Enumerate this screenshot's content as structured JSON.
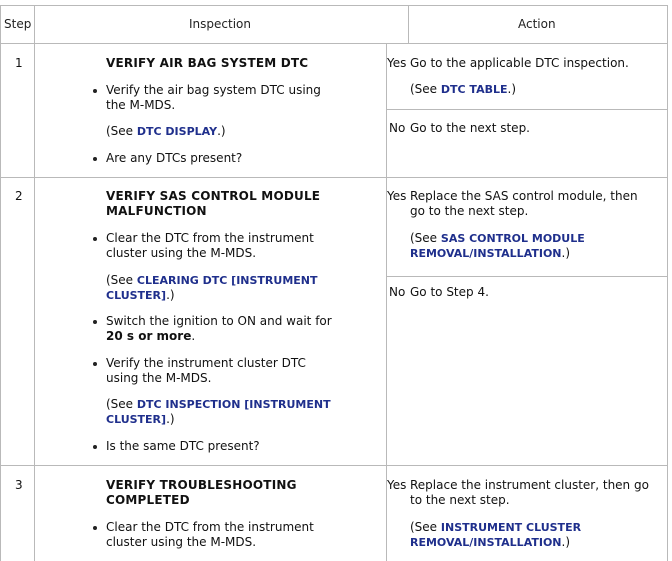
{
  "headers": {
    "step": "Step",
    "inspection": "Inspection",
    "action": "Action"
  },
  "rows": [
    {
      "step": "1",
      "title": "VERIFY AIR BAG SYSTEM DTC",
      "bullet1": [
        "Verify the air bag system DTC using",
        "the M-MDS."
      ],
      "ref1": {
        "pre": "(See ",
        "link": "DTC DISPLAY",
        "post": ".)"
      },
      "bullet2": "Are any DTCs present?",
      "yes_label": "Yes",
      "yes_text": "Go to the applicable DTC inspection.",
      "yes_ref": {
        "pre": "(See ",
        "link": "DTC TABLE",
        "post": ".)"
      },
      "no_label": "No",
      "no_text": "Go to the next step."
    },
    {
      "step": "2",
      "title": [
        "VERIFY SAS CONTROL MODULE",
        "MALFUNCTION"
      ],
      "bullet1": [
        "Clear the DTC from the instrument",
        "cluster using the M-MDS."
      ],
      "ref1": {
        "pre": "(See ",
        "link1": "CLEARING DTC [INSTRUMENT",
        "link2": "CLUSTER]",
        "post": ".)"
      },
      "bullet2": {
        "line1": "Switch the ignition to ON and wait for",
        "strong": "20 s or more",
        "post": "."
      },
      "bullet3": [
        "Verify the instrument cluster DTC",
        "using the M-MDS."
      ],
      "ref2": {
        "pre": "(See ",
        "link1": "DTC INSPECTION [INSTRUMENT",
        "link2": "CLUSTER]",
        "post": ".)"
      },
      "bullet4": "Is the same DTC present?",
      "yes_label": "Yes",
      "yes_text": [
        "Replace the SAS control module, then",
        "go to the next step."
      ],
      "yes_ref": {
        "pre": "(See ",
        "link1": "SAS CONTROL MODULE",
        "link2": "REMOVAL/INSTALLATION",
        "post": ".)"
      },
      "no_label": "No",
      "no_text": "Go to Step 4."
    },
    {
      "step": "3",
      "title": [
        "VERIFY TROUBLESHOOTING",
        "COMPLETED"
      ],
      "bullet1": [
        "Clear the DTC from the instrument",
        "cluster using the M-MDS."
      ],
      "yes_label": "Yes",
      "yes_text": [
        "Replace the instrument cluster, then go",
        "to the next step."
      ],
      "yes_ref": {
        "pre": "(See ",
        "link1": "INSTRUMENT CLUSTER",
        "link2": "REMOVAL/INSTALLATION",
        "post": ".)"
      }
    }
  ]
}
